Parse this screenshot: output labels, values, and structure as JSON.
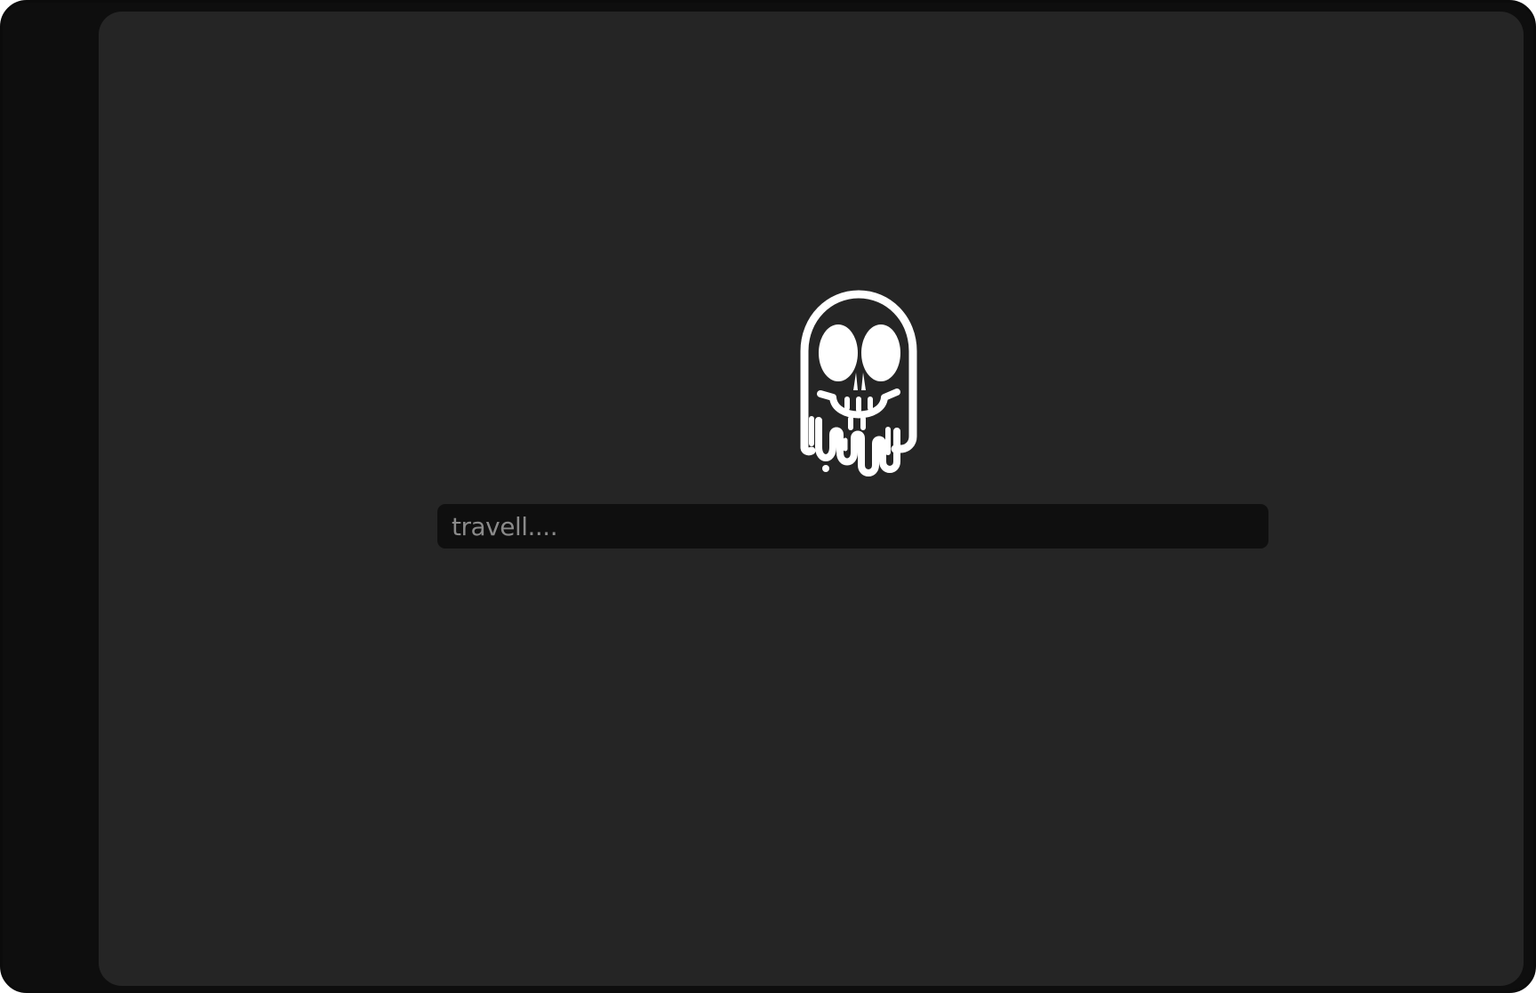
{
  "app": {
    "logo_icon": "dripping-skull-icon",
    "colors": {
      "frame": "#0e0e0e",
      "panel": "#252525",
      "input_background": "#0f0f0f",
      "logo": "#ffffff",
      "placeholder": "#8a8a8a"
    }
  },
  "search": {
    "value": "",
    "placeholder": "travell...."
  }
}
